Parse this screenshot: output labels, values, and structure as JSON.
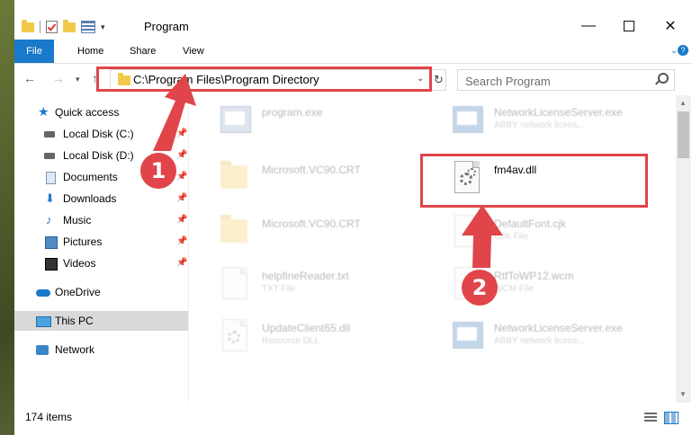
{
  "window": {
    "title": "Program",
    "controls": {
      "minimize": "—",
      "maximize": "",
      "close": "✕"
    }
  },
  "ribbon": {
    "tabs": [
      "File",
      "Home",
      "Share",
      "View"
    ]
  },
  "address": {
    "path": "C:\\Program Files\\Program Directory",
    "refresh": "↻"
  },
  "search": {
    "placeholder": "Search Program"
  },
  "sidebar": {
    "quick_access": "Quick access",
    "items": [
      {
        "label": "Local Disk (C:)",
        "icon": "drive-icon"
      },
      {
        "label": "Local Disk (D:)",
        "icon": "drive-icon"
      },
      {
        "label": "Documents",
        "icon": "documents-icon"
      },
      {
        "label": "Downloads",
        "icon": "downloads-icon"
      },
      {
        "label": "Music",
        "icon": "music-icon"
      },
      {
        "label": "Pictures",
        "icon": "pictures-icon"
      },
      {
        "label": "Videos",
        "icon": "videos-icon"
      }
    ],
    "onedrive": "OneDrive",
    "this_pc": "This PC",
    "network": "Network"
  },
  "files": {
    "left": [
      {
        "name": "program.exe",
        "type": ""
      },
      {
        "name": "Microsoft.VC90.CRT",
        "type": ""
      },
      {
        "name": "Microsoft.VC90.CRT",
        "type": ""
      },
      {
        "name": "helpfineReader.txt",
        "type": "TXT File"
      },
      {
        "name": "UpdateClient65.dll",
        "type": "Resource DLL"
      }
    ],
    "right": [
      {
        "name": "NetworkLicenseServer.exe",
        "type": "ABBY network licens..."
      },
      {
        "name": "fm4av.dll",
        "type": ""
      },
      {
        "name": "DefaultFont.cjk",
        "type": "CJK File"
      },
      {
        "name": "RtfToWP12.wcm",
        "type": "WCM File"
      },
      {
        "name": "NetworkLicenseServer.exe",
        "type": "ABBY network licens..."
      }
    ]
  },
  "status": {
    "items": "174 items"
  },
  "annotations": [
    "1",
    "2"
  ],
  "colors": {
    "accent": "#1979ca",
    "highlight": "#e0454a"
  }
}
